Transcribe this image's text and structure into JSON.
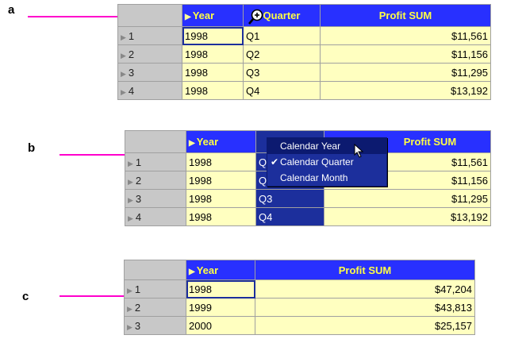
{
  "callouts": {
    "a": "a",
    "b": "b",
    "c": "c"
  },
  "table_a": {
    "headers": [
      "Year",
      "Quarter",
      "Profit SUM"
    ],
    "rows": [
      {
        "num": "1",
        "year": "1998",
        "quarter": "Q1",
        "profit": "$11,561"
      },
      {
        "num": "2",
        "year": "1998",
        "quarter": "Q2",
        "profit": "$11,156"
      },
      {
        "num": "3",
        "year": "1998",
        "quarter": "Q3",
        "profit": "$11,295"
      },
      {
        "num": "4",
        "year": "1998",
        "quarter": "Q4",
        "profit": "$13,192"
      }
    ]
  },
  "table_b": {
    "headers": [
      "Year",
      "",
      "Profit SUM"
    ],
    "rows": [
      {
        "num": "1",
        "year": "1998",
        "quarter": "Q",
        "profit": "$11,561"
      },
      {
        "num": "2",
        "year": "1998",
        "quarter": "Q",
        "profit": "$11,156"
      },
      {
        "num": "3",
        "year": "1998",
        "quarter": "Q3",
        "profit": "$11,295"
      },
      {
        "num": "4",
        "year": "1998",
        "quarter": "Q4",
        "profit": "$13,192"
      }
    ],
    "context_menu": [
      "Calendar Year",
      "Calendar Quarter",
      "Calendar Month"
    ],
    "checked_item": "Calendar Quarter"
  },
  "table_c": {
    "headers": [
      "Year",
      "Profit SUM"
    ],
    "rows": [
      {
        "num": "1",
        "year": "1998",
        "profit": "$47,204"
      },
      {
        "num": "2",
        "year": "1999",
        "profit": "$43,813"
      },
      {
        "num": "3",
        "year": "2000",
        "profit": "$25,157"
      }
    ]
  },
  "colors": {
    "header_bg": "#2830ff",
    "header_text": "#ffff44",
    "cell_bg": "#ffffc0",
    "callout_line": "#ff00cc"
  }
}
